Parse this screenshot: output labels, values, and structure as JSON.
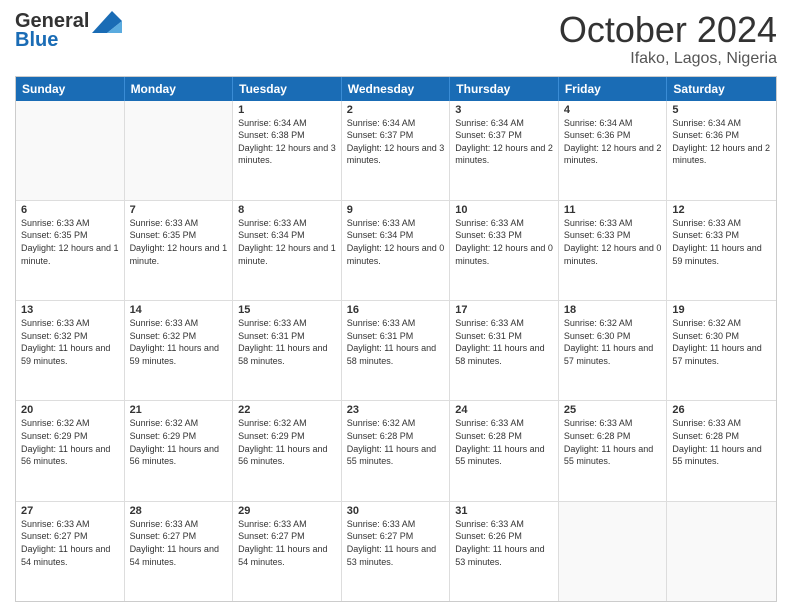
{
  "logo": {
    "line1": "General",
    "line2": "Blue"
  },
  "title": "October 2024",
  "location": "Ifako, Lagos, Nigeria",
  "days_of_week": [
    "Sunday",
    "Monday",
    "Tuesday",
    "Wednesday",
    "Thursday",
    "Friday",
    "Saturday"
  ],
  "weeks": [
    [
      {
        "day": "",
        "empty": true
      },
      {
        "day": "",
        "empty": true
      },
      {
        "day": "1",
        "sunrise": "6:34 AM",
        "sunset": "6:38 PM",
        "daylight": "12 hours and 3 minutes."
      },
      {
        "day": "2",
        "sunrise": "6:34 AM",
        "sunset": "6:37 PM",
        "daylight": "12 hours and 3 minutes."
      },
      {
        "day": "3",
        "sunrise": "6:34 AM",
        "sunset": "6:37 PM",
        "daylight": "12 hours and 2 minutes."
      },
      {
        "day": "4",
        "sunrise": "6:34 AM",
        "sunset": "6:36 PM",
        "daylight": "12 hours and 2 minutes."
      },
      {
        "day": "5",
        "sunrise": "6:34 AM",
        "sunset": "6:36 PM",
        "daylight": "12 hours and 2 minutes."
      }
    ],
    [
      {
        "day": "6",
        "sunrise": "6:33 AM",
        "sunset": "6:35 PM",
        "daylight": "12 hours and 1 minute."
      },
      {
        "day": "7",
        "sunrise": "6:33 AM",
        "sunset": "6:35 PM",
        "daylight": "12 hours and 1 minute."
      },
      {
        "day": "8",
        "sunrise": "6:33 AM",
        "sunset": "6:34 PM",
        "daylight": "12 hours and 1 minute."
      },
      {
        "day": "9",
        "sunrise": "6:33 AM",
        "sunset": "6:34 PM",
        "daylight": "12 hours and 0 minutes."
      },
      {
        "day": "10",
        "sunrise": "6:33 AM",
        "sunset": "6:33 PM",
        "daylight": "12 hours and 0 minutes."
      },
      {
        "day": "11",
        "sunrise": "6:33 AM",
        "sunset": "6:33 PM",
        "daylight": "12 hours and 0 minutes."
      },
      {
        "day": "12",
        "sunrise": "6:33 AM",
        "sunset": "6:33 PM",
        "daylight": "11 hours and 59 minutes."
      }
    ],
    [
      {
        "day": "13",
        "sunrise": "6:33 AM",
        "sunset": "6:32 PM",
        "daylight": "11 hours and 59 minutes."
      },
      {
        "day": "14",
        "sunrise": "6:33 AM",
        "sunset": "6:32 PM",
        "daylight": "11 hours and 59 minutes."
      },
      {
        "day": "15",
        "sunrise": "6:33 AM",
        "sunset": "6:31 PM",
        "daylight": "11 hours and 58 minutes."
      },
      {
        "day": "16",
        "sunrise": "6:33 AM",
        "sunset": "6:31 PM",
        "daylight": "11 hours and 58 minutes."
      },
      {
        "day": "17",
        "sunrise": "6:33 AM",
        "sunset": "6:31 PM",
        "daylight": "11 hours and 58 minutes."
      },
      {
        "day": "18",
        "sunrise": "6:32 AM",
        "sunset": "6:30 PM",
        "daylight": "11 hours and 57 minutes."
      },
      {
        "day": "19",
        "sunrise": "6:32 AM",
        "sunset": "6:30 PM",
        "daylight": "11 hours and 57 minutes."
      }
    ],
    [
      {
        "day": "20",
        "sunrise": "6:32 AM",
        "sunset": "6:29 PM",
        "daylight": "11 hours and 56 minutes."
      },
      {
        "day": "21",
        "sunrise": "6:32 AM",
        "sunset": "6:29 PM",
        "daylight": "11 hours and 56 minutes."
      },
      {
        "day": "22",
        "sunrise": "6:32 AM",
        "sunset": "6:29 PM",
        "daylight": "11 hours and 56 minutes."
      },
      {
        "day": "23",
        "sunrise": "6:32 AM",
        "sunset": "6:28 PM",
        "daylight": "11 hours and 55 minutes."
      },
      {
        "day": "24",
        "sunrise": "6:33 AM",
        "sunset": "6:28 PM",
        "daylight": "11 hours and 55 minutes."
      },
      {
        "day": "25",
        "sunrise": "6:33 AM",
        "sunset": "6:28 PM",
        "daylight": "11 hours and 55 minutes."
      },
      {
        "day": "26",
        "sunrise": "6:33 AM",
        "sunset": "6:28 PM",
        "daylight": "11 hours and 55 minutes."
      }
    ],
    [
      {
        "day": "27",
        "sunrise": "6:33 AM",
        "sunset": "6:27 PM",
        "daylight": "11 hours and 54 minutes."
      },
      {
        "day": "28",
        "sunrise": "6:33 AM",
        "sunset": "6:27 PM",
        "daylight": "11 hours and 54 minutes."
      },
      {
        "day": "29",
        "sunrise": "6:33 AM",
        "sunset": "6:27 PM",
        "daylight": "11 hours and 54 minutes."
      },
      {
        "day": "30",
        "sunrise": "6:33 AM",
        "sunset": "6:27 PM",
        "daylight": "11 hours and 53 minutes."
      },
      {
        "day": "31",
        "sunrise": "6:33 AM",
        "sunset": "6:26 PM",
        "daylight": "11 hours and 53 minutes."
      },
      {
        "day": "",
        "empty": true
      },
      {
        "day": "",
        "empty": true
      }
    ]
  ]
}
